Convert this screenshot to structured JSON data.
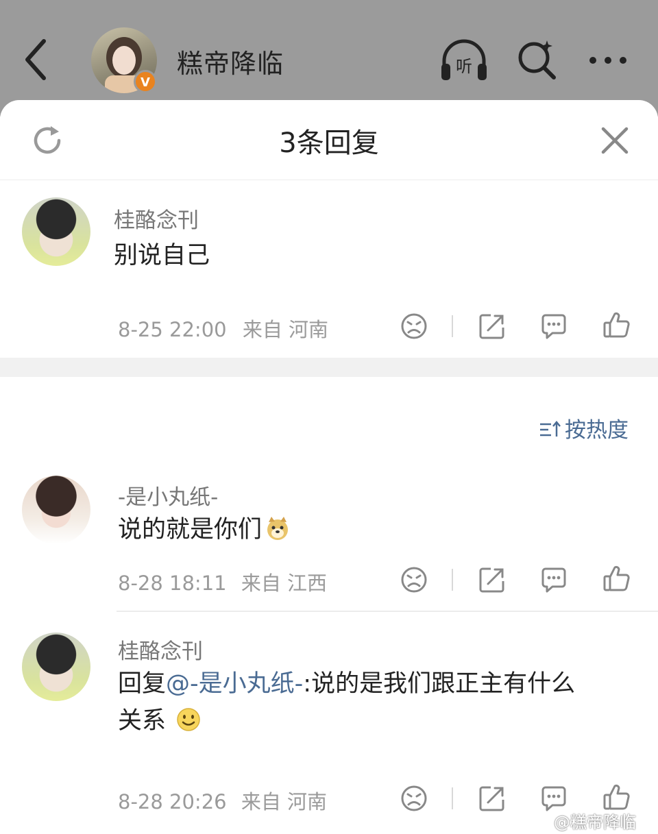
{
  "header": {
    "name": "糕帝降临",
    "badge": "V"
  },
  "sheet": {
    "title": "3条回复"
  },
  "root_comment": {
    "user": "桂酪念刊",
    "text": "别说自己",
    "time": "8-25 22:00",
    "location": "来自 河南"
  },
  "sort": {
    "label": "按热度"
  },
  "replies": [
    {
      "user": "-是小丸纸-",
      "text": "说的就是你们",
      "emoji": "doge-emoji",
      "time": "8-28 18:11",
      "location": "来自 江西"
    },
    {
      "user": "桂酪念刊",
      "text_prefix": "回复",
      "mention": "@-是小丸纸-",
      "text_line1": ":说的是我们跟正主有什么",
      "text_line2": "关系",
      "emoji": "smile-emoji",
      "time": "8-28 20:26",
      "location": "来自 河南"
    }
  ],
  "watermark": "@糕帝降临",
  "icons": [
    "back-icon",
    "listen-icon",
    "search-icon",
    "more-icon",
    "refresh-icon",
    "close-icon",
    "dislike-icon",
    "share-icon",
    "comment-icon",
    "like-icon"
  ],
  "colors": {
    "topbar": "#9b9b9b",
    "accent": "#4a6b93",
    "badge": "#e9831f"
  }
}
